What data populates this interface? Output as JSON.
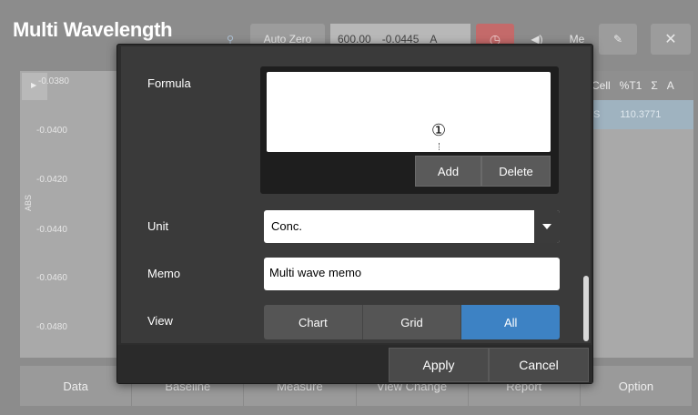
{
  "app": {
    "title": "Multi Wavelength",
    "toolbar": {
      "auto_zero": "Auto Zero",
      "wavelength": "600.00",
      "abs_value": "-0.0445",
      "abs_unit": "A"
    },
    "chart": {
      "y_label": "ABS",
      "y_ticks": [
        "-0.0380",
        "-0.0400",
        "-0.0420",
        "-0.0440",
        "-0.0460",
        "-0.0480"
      ]
    },
    "table": {
      "headers": [
        "Cell",
        "%T1",
        "Σ",
        "A"
      ],
      "row_value": "110.3771"
    },
    "bottom_tabs": [
      "Data",
      "Baseline",
      "Measure",
      "View Change",
      "Report",
      "Option"
    ]
  },
  "dialog": {
    "formula_label": "Formula",
    "formula_value": "",
    "marker": "①",
    "add_label": "Add",
    "delete_label": "Delete",
    "unit_label": "Unit",
    "unit_value": "Conc.",
    "memo_label": "Memo",
    "memo_value": "Multi wave memo",
    "view_label": "View",
    "view_options": [
      "Chart",
      "Grid",
      "All"
    ],
    "view_selected": "All",
    "apply_label": "Apply",
    "cancel_label": "Cancel"
  }
}
